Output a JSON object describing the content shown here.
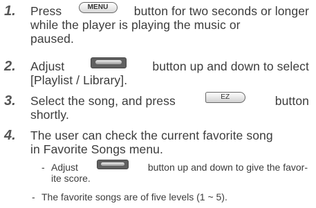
{
  "steps": [
    {
      "number": "1.",
      "line1_before": "Press",
      "button": "MENU",
      "line1_after": "button for two seconds or longer",
      "line2": "while the player is playing the music or",
      "line3": "paused."
    },
    {
      "number": "2.",
      "line1_before": "Adjust",
      "button_icon": "jog-button-icon",
      "line1_after": "button up and down to select",
      "line2": "[Playlist / Library]."
    },
    {
      "number": "3.",
      "line1_before": "Select the song, and press",
      "button": "EZ",
      "line1_after": "button",
      "line2": "shortly."
    },
    {
      "number": "4.",
      "line1": "The user can check the current favorite song",
      "line2": "in Favorite Songs menu."
    }
  ],
  "notes": [
    {
      "dash": "-",
      "before": "Adjust",
      "button_icon": "jog-button-icon",
      "after": "button up and down to give the favor-",
      "line2": "ite score."
    },
    {
      "dash": "-",
      "text": "The favorite songs are of five levels (1 ~ 5)."
    }
  ]
}
